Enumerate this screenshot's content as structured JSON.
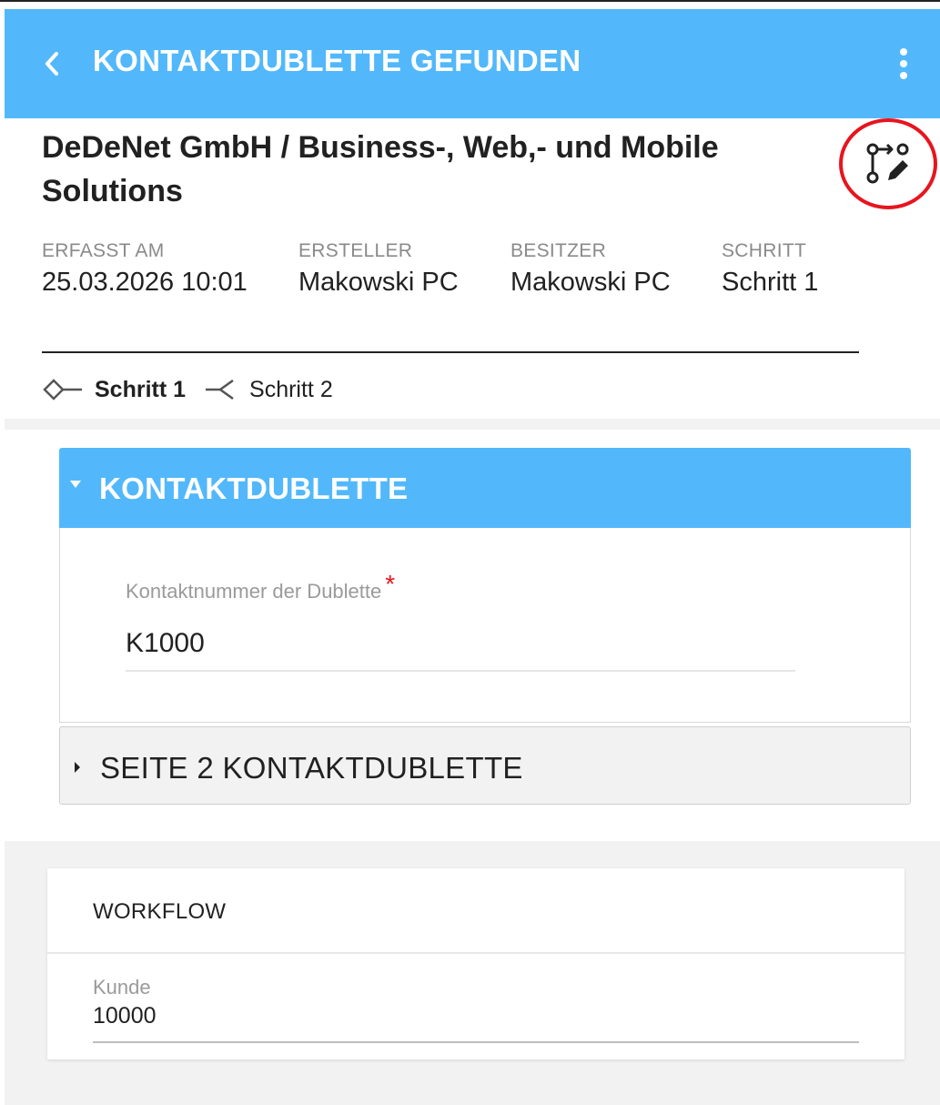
{
  "appbar": {
    "title": "KONTAKTDUBLETTE GEFUNDEN"
  },
  "record": {
    "title_line1": "DeDeNet GmbH / Business-, Web,- und Mobile",
    "title_line2": "Solutions"
  },
  "meta": [
    {
      "label": "ERFASST AM",
      "value": "25.03.2026 10:01"
    },
    {
      "label": "ERSTELLER",
      "value": "Makowski PC"
    },
    {
      "label": "BESITZER",
      "value": "Makowski PC"
    },
    {
      "label": "SCHRITT",
      "value": "Schritt 1"
    }
  ],
  "steps": [
    {
      "label": "Schritt 1",
      "active": true
    },
    {
      "label": "Schritt 2",
      "active": false
    }
  ],
  "section1": {
    "title": "KONTAKTDUBLETTE",
    "field_label": "Kontaktnummer der Dublette",
    "required_mark": "*",
    "field_value": "K1000"
  },
  "section2": {
    "title": "SEITE 2 KONTAKTDUBLETTE"
  },
  "workflow": {
    "title": "WORKFLOW",
    "kunde_label": "Kunde",
    "kunde_value": "10000"
  },
  "colors": {
    "accent": "#52b8fb",
    "highlight_ring": "#e8141e",
    "required": "#e8141e"
  }
}
